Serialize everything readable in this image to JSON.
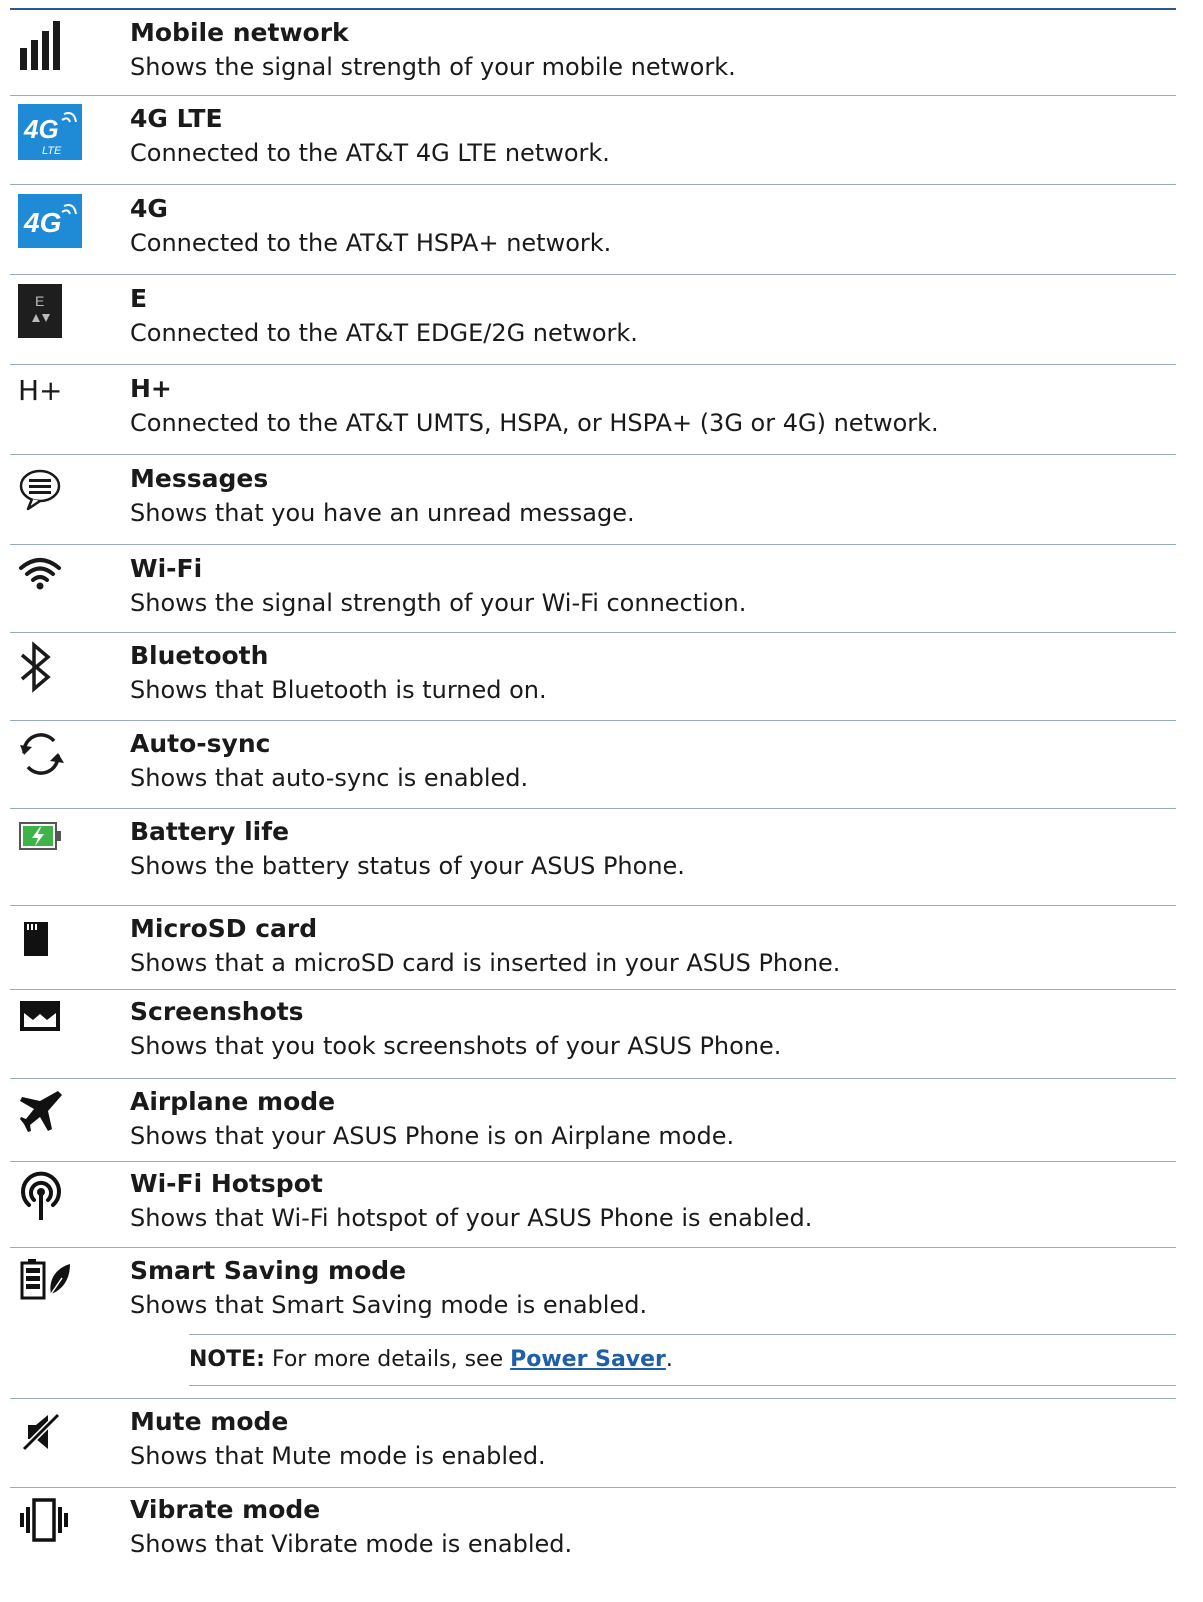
{
  "entries": [
    {
      "icon": "mobile-signal-icon",
      "title": "Mobile network",
      "desc": "Shows the signal strength of your mobile network."
    },
    {
      "icon": "4g-lte-icon",
      "title": "4G LTE",
      "desc": "Connected to the AT&T 4G LTE network."
    },
    {
      "icon": "4g-icon",
      "title": "4G",
      "desc": "Connected to the AT&T HSPA+ network."
    },
    {
      "icon": "edge-icon",
      "title": "E",
      "desc": "Connected to the AT&T EDGE/2G network."
    },
    {
      "icon": "h-plus-icon",
      "title": "H+",
      "desc": "Connected to the AT&T UMTS, HSPA, or HSPA+ (3G or 4G) network."
    },
    {
      "icon": "message-icon",
      "title": "Messages",
      "desc": "Shows that you have an unread message."
    },
    {
      "icon": "wifi-icon",
      "title": "Wi-Fi",
      "desc": "Shows the signal strength of your Wi-Fi connection."
    },
    {
      "icon": "bluetooth-icon",
      "title": "Bluetooth",
      "desc": "Shows that Bluetooth is turned on."
    },
    {
      "icon": "sync-icon",
      "title": "Auto-sync",
      "desc": "Shows that auto-sync is enabled."
    },
    {
      "icon": "battery-icon",
      "title": "Battery life",
      "desc": "Shows the battery status of your ASUS Phone."
    },
    {
      "icon": "microsd-icon",
      "title": "MicroSD card",
      "desc": "Shows that a microSD card is inserted in your ASUS Phone."
    },
    {
      "icon": "screenshot-icon",
      "title": "Screenshots",
      "desc": "Shows that you took screenshots of your ASUS Phone."
    },
    {
      "icon": "airplane-icon",
      "title": "Airplane mode",
      "desc": "Shows that your ASUS Phone is on Airplane mode."
    },
    {
      "icon": "hotspot-icon",
      "title": "Wi-Fi Hotspot",
      "desc": "Shows that Wi-Fi hotspot of your ASUS Phone is enabled."
    },
    {
      "icon": "smart-saving-icon",
      "title": "Smart Saving mode",
      "desc": "Shows that Smart Saving mode is enabled."
    },
    {
      "icon": "mute-icon",
      "title": "Mute mode",
      "desc": "Shows that Mute mode is enabled."
    },
    {
      "icon": "vibrate-icon",
      "title": "Vibrate mode",
      "desc": "Shows that Vibrate mode is enabled."
    }
  ],
  "icon_text": {
    "lte_big": "4G",
    "lte_small": "LTE",
    "g4_big": "4G",
    "edge_letter": "E",
    "hplus": "H+"
  },
  "note": {
    "label": "NOTE:",
    "text": " For more details, see ",
    "link": "Power Saver",
    "end": "."
  },
  "colors": {
    "rule": "#2b5797",
    "separator": "#9aaac8",
    "link": "#1f5fa8",
    "tile_blue": "#1f8ad6",
    "battery_green": "#3db34a"
  }
}
